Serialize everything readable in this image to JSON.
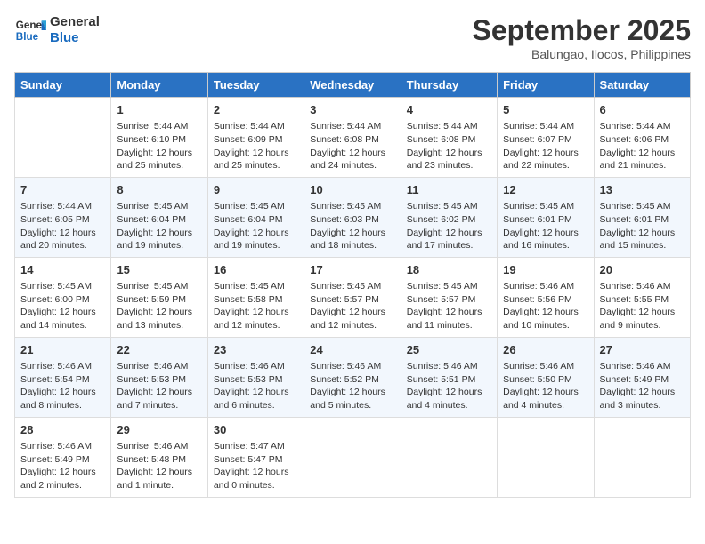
{
  "header": {
    "logo_line1": "General",
    "logo_line2": "Blue",
    "month": "September 2025",
    "location": "Balungao, Ilocos, Philippines"
  },
  "days_of_week": [
    "Sunday",
    "Monday",
    "Tuesday",
    "Wednesday",
    "Thursday",
    "Friday",
    "Saturday"
  ],
  "weeks": [
    [
      {
        "day": "",
        "info": ""
      },
      {
        "day": "1",
        "info": "Sunrise: 5:44 AM\nSunset: 6:10 PM\nDaylight: 12 hours\nand 25 minutes."
      },
      {
        "day": "2",
        "info": "Sunrise: 5:44 AM\nSunset: 6:09 PM\nDaylight: 12 hours\nand 25 minutes."
      },
      {
        "day": "3",
        "info": "Sunrise: 5:44 AM\nSunset: 6:08 PM\nDaylight: 12 hours\nand 24 minutes."
      },
      {
        "day": "4",
        "info": "Sunrise: 5:44 AM\nSunset: 6:08 PM\nDaylight: 12 hours\nand 23 minutes."
      },
      {
        "day": "5",
        "info": "Sunrise: 5:44 AM\nSunset: 6:07 PM\nDaylight: 12 hours\nand 22 minutes."
      },
      {
        "day": "6",
        "info": "Sunrise: 5:44 AM\nSunset: 6:06 PM\nDaylight: 12 hours\nand 21 minutes."
      }
    ],
    [
      {
        "day": "7",
        "info": "Sunrise: 5:44 AM\nSunset: 6:05 PM\nDaylight: 12 hours\nand 20 minutes."
      },
      {
        "day": "8",
        "info": "Sunrise: 5:45 AM\nSunset: 6:04 PM\nDaylight: 12 hours\nand 19 minutes."
      },
      {
        "day": "9",
        "info": "Sunrise: 5:45 AM\nSunset: 6:04 PM\nDaylight: 12 hours\nand 19 minutes."
      },
      {
        "day": "10",
        "info": "Sunrise: 5:45 AM\nSunset: 6:03 PM\nDaylight: 12 hours\nand 18 minutes."
      },
      {
        "day": "11",
        "info": "Sunrise: 5:45 AM\nSunset: 6:02 PM\nDaylight: 12 hours\nand 17 minutes."
      },
      {
        "day": "12",
        "info": "Sunrise: 5:45 AM\nSunset: 6:01 PM\nDaylight: 12 hours\nand 16 minutes."
      },
      {
        "day": "13",
        "info": "Sunrise: 5:45 AM\nSunset: 6:01 PM\nDaylight: 12 hours\nand 15 minutes."
      }
    ],
    [
      {
        "day": "14",
        "info": "Sunrise: 5:45 AM\nSunset: 6:00 PM\nDaylight: 12 hours\nand 14 minutes."
      },
      {
        "day": "15",
        "info": "Sunrise: 5:45 AM\nSunset: 5:59 PM\nDaylight: 12 hours\nand 13 minutes."
      },
      {
        "day": "16",
        "info": "Sunrise: 5:45 AM\nSunset: 5:58 PM\nDaylight: 12 hours\nand 12 minutes."
      },
      {
        "day": "17",
        "info": "Sunrise: 5:45 AM\nSunset: 5:57 PM\nDaylight: 12 hours\nand 12 minutes."
      },
      {
        "day": "18",
        "info": "Sunrise: 5:45 AM\nSunset: 5:57 PM\nDaylight: 12 hours\nand 11 minutes."
      },
      {
        "day": "19",
        "info": "Sunrise: 5:46 AM\nSunset: 5:56 PM\nDaylight: 12 hours\nand 10 minutes."
      },
      {
        "day": "20",
        "info": "Sunrise: 5:46 AM\nSunset: 5:55 PM\nDaylight: 12 hours\nand 9 minutes."
      }
    ],
    [
      {
        "day": "21",
        "info": "Sunrise: 5:46 AM\nSunset: 5:54 PM\nDaylight: 12 hours\nand 8 minutes."
      },
      {
        "day": "22",
        "info": "Sunrise: 5:46 AM\nSunset: 5:53 PM\nDaylight: 12 hours\nand 7 minutes."
      },
      {
        "day": "23",
        "info": "Sunrise: 5:46 AM\nSunset: 5:53 PM\nDaylight: 12 hours\nand 6 minutes."
      },
      {
        "day": "24",
        "info": "Sunrise: 5:46 AM\nSunset: 5:52 PM\nDaylight: 12 hours\nand 5 minutes."
      },
      {
        "day": "25",
        "info": "Sunrise: 5:46 AM\nSunset: 5:51 PM\nDaylight: 12 hours\nand 4 minutes."
      },
      {
        "day": "26",
        "info": "Sunrise: 5:46 AM\nSunset: 5:50 PM\nDaylight: 12 hours\nand 4 minutes."
      },
      {
        "day": "27",
        "info": "Sunrise: 5:46 AM\nSunset: 5:49 PM\nDaylight: 12 hours\nand 3 minutes."
      }
    ],
    [
      {
        "day": "28",
        "info": "Sunrise: 5:46 AM\nSunset: 5:49 PM\nDaylight: 12 hours\nand 2 minutes."
      },
      {
        "day": "29",
        "info": "Sunrise: 5:46 AM\nSunset: 5:48 PM\nDaylight: 12 hours\nand 1 minute."
      },
      {
        "day": "30",
        "info": "Sunrise: 5:47 AM\nSunset: 5:47 PM\nDaylight: 12 hours\nand 0 minutes."
      },
      {
        "day": "",
        "info": ""
      },
      {
        "day": "",
        "info": ""
      },
      {
        "day": "",
        "info": ""
      },
      {
        "day": "",
        "info": ""
      }
    ]
  ]
}
